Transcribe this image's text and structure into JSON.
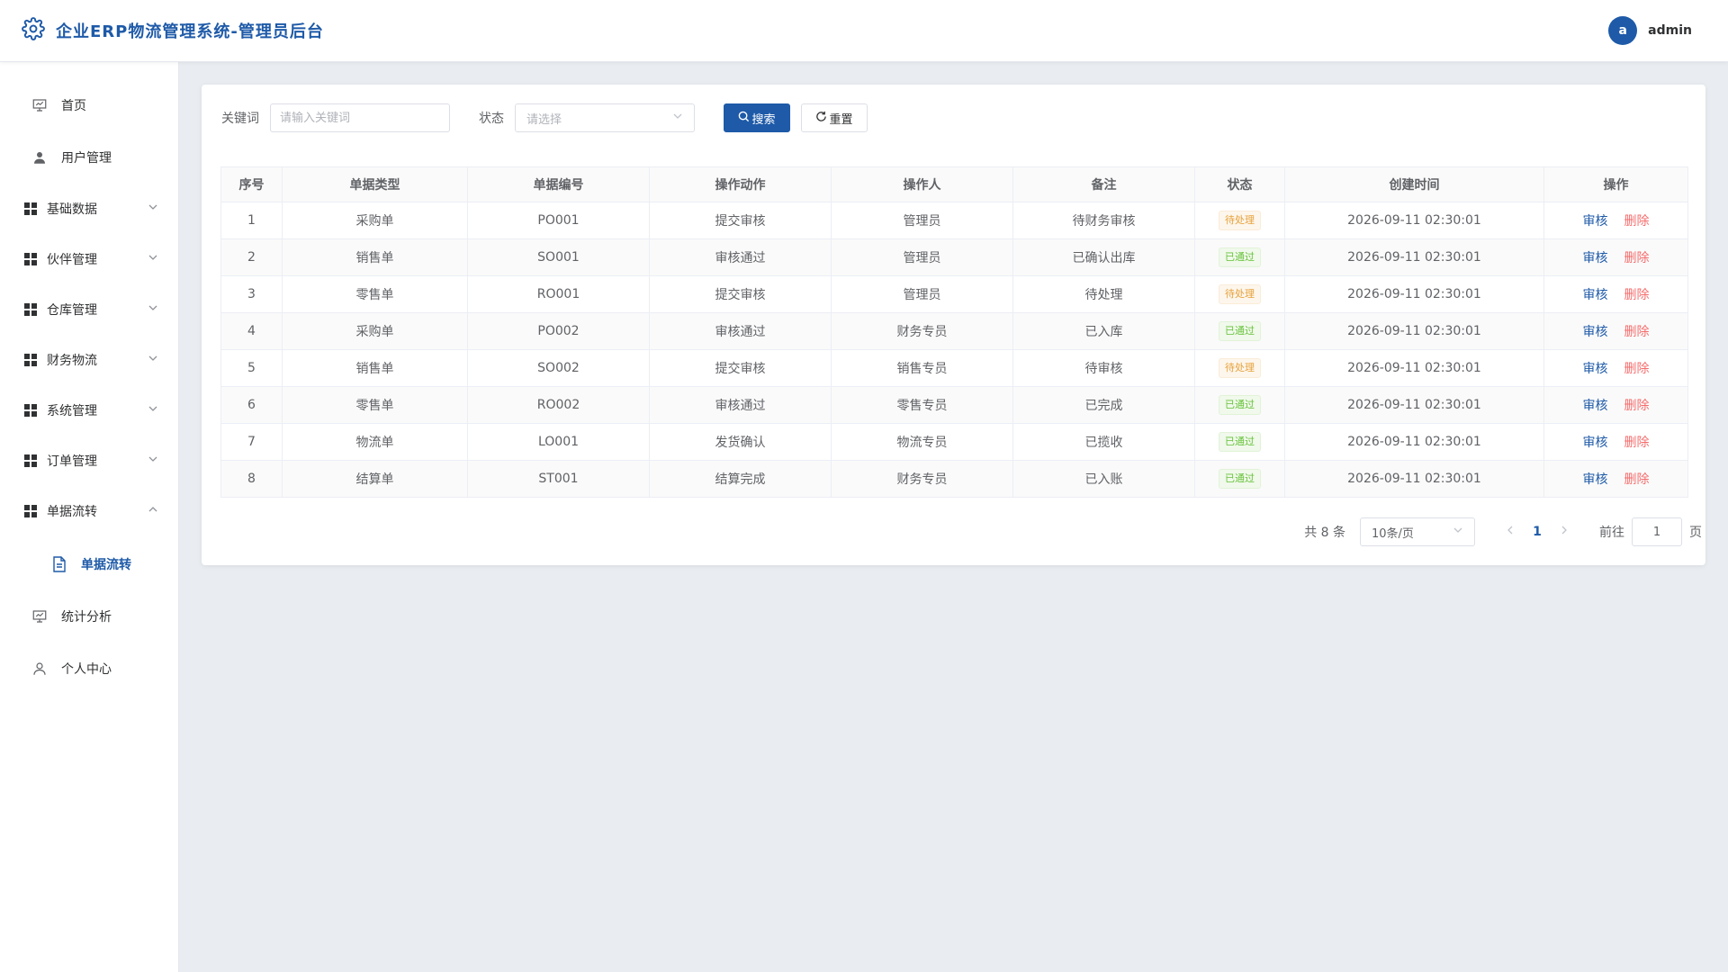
{
  "app": {
    "title": "企业ERP物流管理系统-管理员后台",
    "brand_color": "#1e5aa8"
  },
  "user": {
    "avatar_letter": "a",
    "name": "admin"
  },
  "sidebar": {
    "home": "首页",
    "users": "用户管理",
    "groups": [
      "基础数据",
      "伙伴管理",
      "仓库管理",
      "财务物流",
      "系统管理",
      "订单管理",
      "单据流转"
    ],
    "sub_active": "单据流转",
    "stats": "统计分析",
    "profile": "个人中心"
  },
  "filter": {
    "keyword_label": "关键词",
    "keyword_placeholder": "请输入关键词",
    "status_label": "状态",
    "status_placeholder": "请选择",
    "search_label": "搜索",
    "reset_label": "重置"
  },
  "table": {
    "headers": [
      "序号",
      "单据类型",
      "单据编号",
      "操作动作",
      "操作人",
      "备注",
      "状态",
      "创建时间",
      "操作"
    ],
    "rows": [
      {
        "no": "1",
        "type": "采购单",
        "code": "PO001",
        "action": "提交审核",
        "operator": "管理员",
        "remark": "待财务审核",
        "status": "待处理",
        "time": "2026-09-11 02:30:01"
      },
      {
        "no": "2",
        "type": "销售单",
        "code": "SO001",
        "action": "审核通过",
        "operator": "管理员",
        "remark": "已确认出库",
        "status": "已通过",
        "time": "2026-09-11 02:30:01"
      },
      {
        "no": "3",
        "type": "零售单",
        "code": "RO001",
        "action": "提交审核",
        "operator": "管理员",
        "remark": "待处理",
        "status": "待处理",
        "time": "2026-09-11 02:30:01"
      },
      {
        "no": "4",
        "type": "采购单",
        "code": "PO002",
        "action": "审核通过",
        "operator": "财务专员",
        "remark": "已入库",
        "status": "已通过",
        "time": "2026-09-11 02:30:01"
      },
      {
        "no": "5",
        "type": "销售单",
        "code": "SO002",
        "action": "提交审核",
        "operator": "销售专员",
        "remark": "待审核",
        "status": "待处理",
        "time": "2026-09-11 02:30:01"
      },
      {
        "no": "6",
        "type": "零售单",
        "code": "RO002",
        "action": "审核通过",
        "operator": "零售专员",
        "remark": "已完成",
        "status": "已通过",
        "time": "2026-09-11 02:30:01"
      },
      {
        "no": "7",
        "type": "物流单",
        "code": "LO001",
        "action": "发货确认",
        "operator": "物流专员",
        "remark": "已揽收",
        "status": "已通过",
        "time": "2026-09-11 02:30:01"
      },
      {
        "no": "8",
        "type": "结算单",
        "code": "ST001",
        "action": "结算完成",
        "operator": "财务专员",
        "remark": "已入账",
        "status": "已通过",
        "time": "2026-09-11 02:30:01"
      }
    ],
    "op_audit": "审核",
    "op_delete": "删除"
  },
  "pagination": {
    "total_text": "共 8 条",
    "page_size": "10条/页",
    "current_page": "1",
    "goto_label": "前往",
    "goto_value": "1",
    "page_suffix": "页"
  }
}
